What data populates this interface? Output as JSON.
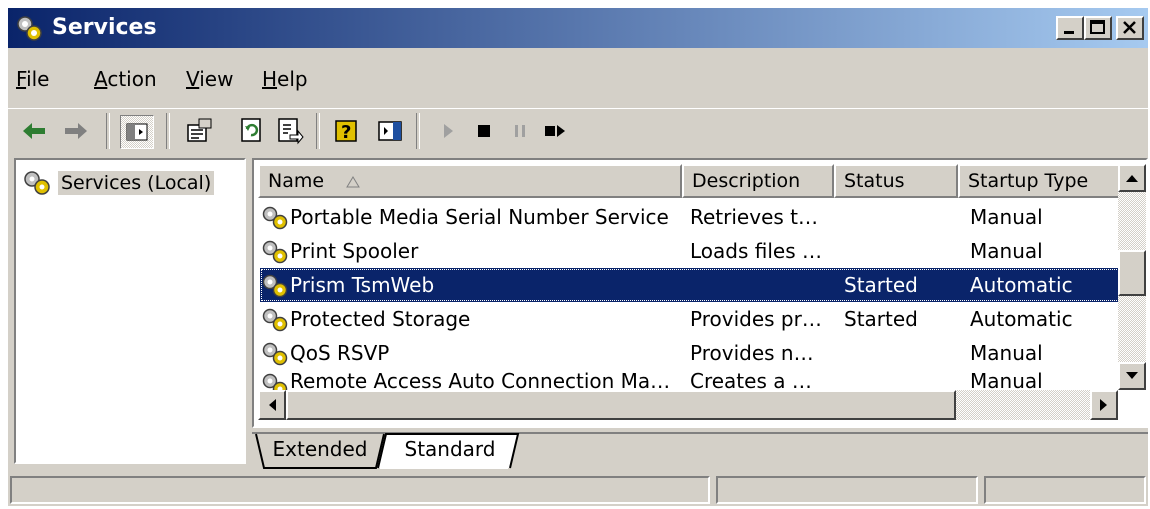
{
  "window": {
    "title": "Services",
    "colors": {
      "title_start": "#0a246a",
      "title_end": "#a6caf0",
      "face": "#d4d0c8",
      "selection": "#0a246a"
    }
  },
  "menu": [
    {
      "label": "File"
    },
    {
      "label": "Action"
    },
    {
      "label": "View"
    },
    {
      "label": "Help"
    }
  ],
  "toolbar": {
    "buttons": [
      "back-arrow-icon",
      "forward-arrow-icon",
      "show-hide-tree-icon",
      "properties-icon",
      "refresh-icon",
      "export-list-icon",
      "help-icon",
      "show-hide-action-pane-icon",
      "start-service-icon",
      "stop-service-icon",
      "pause-service-icon",
      "restart-service-icon"
    ]
  },
  "tree": {
    "root_label": "Services (Local)"
  },
  "list": {
    "columns": [
      "Name",
      "Description",
      "Status",
      "Startup Type"
    ],
    "rows": [
      {
        "name": "Portable Media Serial Number Service",
        "description": "Retrieves t…",
        "status": "",
        "startup": "Manual",
        "selected": false
      },
      {
        "name": "Print Spooler",
        "description": "Loads files …",
        "status": "",
        "startup": "Manual",
        "selected": false
      },
      {
        "name": "Prism TsmWeb",
        "description": "",
        "status": "Started",
        "startup": "Automatic",
        "selected": true
      },
      {
        "name": "Protected Storage",
        "description": "Provides pr…",
        "status": "Started",
        "startup": "Automatic",
        "selected": false
      },
      {
        "name": "QoS RSVP",
        "description": "Provides n…",
        "status": "",
        "startup": "Manual",
        "selected": false
      },
      {
        "name": "Remote Access Auto Connection Ma…",
        "description": "Creates a …",
        "status": "",
        "startup": "Manual",
        "selected": false
      }
    ]
  },
  "tabs": [
    {
      "label": "Extended",
      "active": false
    },
    {
      "label": "Standard",
      "active": true
    }
  ]
}
